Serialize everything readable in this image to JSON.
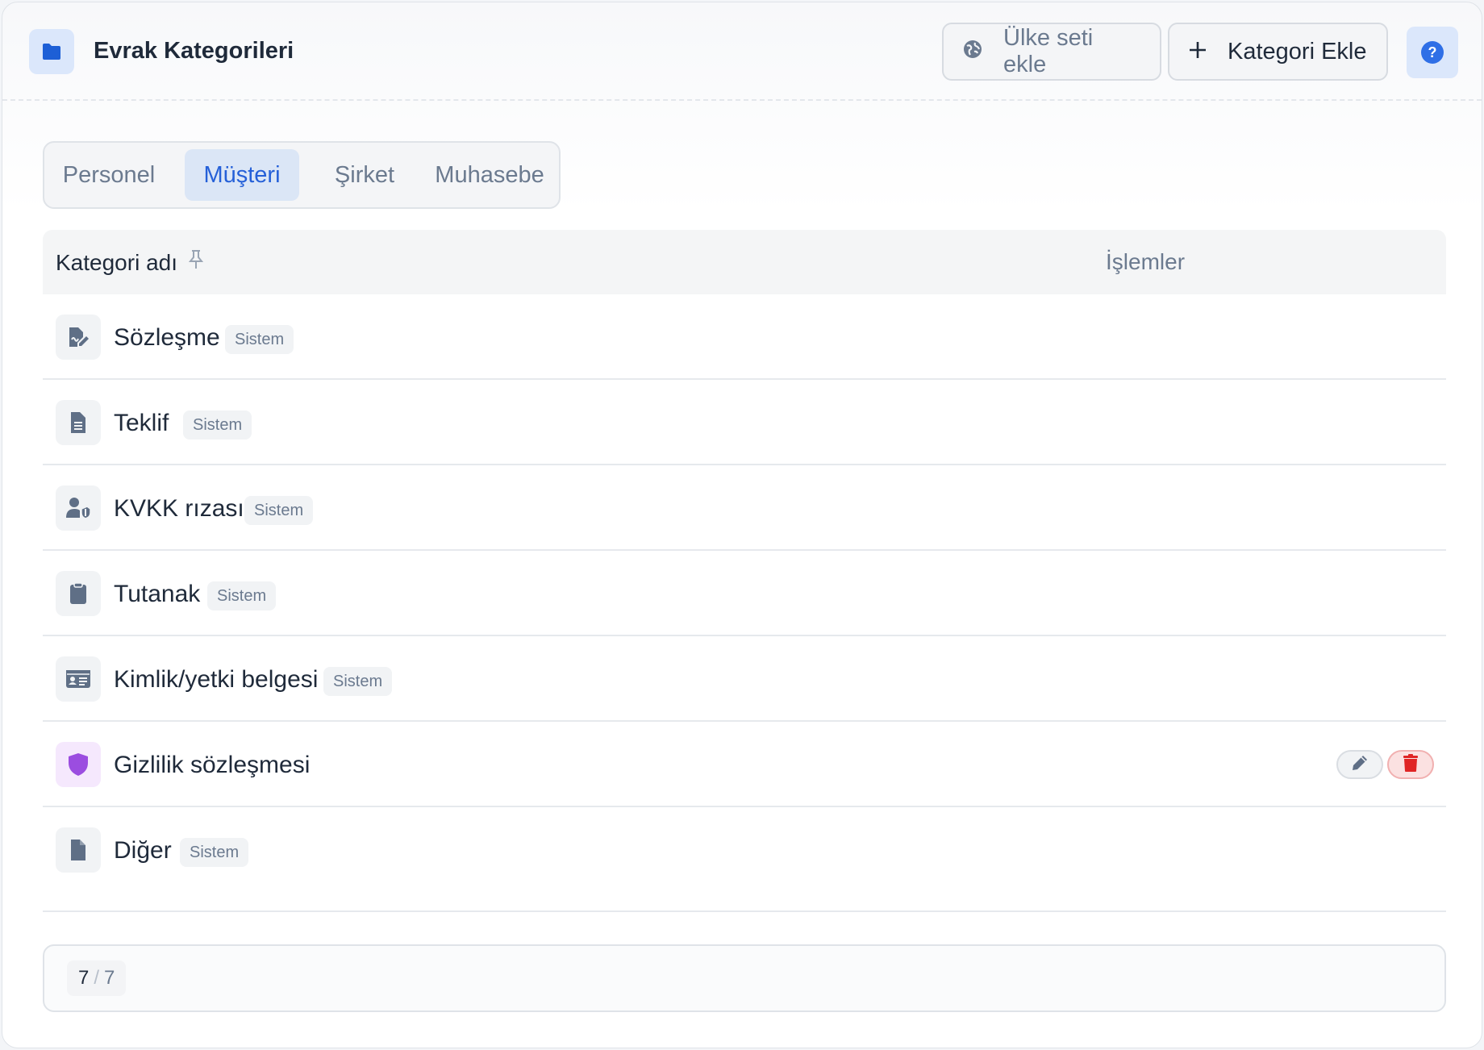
{
  "header": {
    "title": "Evrak Kategorileri",
    "country_button": "Ülke seti ekle",
    "add_button": "Kategori Ekle",
    "help_label": "?"
  },
  "tabs": [
    {
      "label": "Personel",
      "active": false
    },
    {
      "label": "Müşteri",
      "active": true
    },
    {
      "label": "Şirket",
      "active": false
    },
    {
      "label": "Muhasebe",
      "active": false
    }
  ],
  "table": {
    "col_name": "Kategori adı",
    "col_actions": "İşlemler",
    "rows": [
      {
        "name": "Sözleşme",
        "badge": "Sistem",
        "icon": "file-signature-icon"
      },
      {
        "name": "Teklif",
        "badge": "Sistem",
        "icon": "file-text-icon"
      },
      {
        "name": "KVKK rızası",
        "badge": "Sistem",
        "icon": "user-shield-icon"
      },
      {
        "name": "Tutanak",
        "badge": "Sistem",
        "icon": "clipboard-icon"
      },
      {
        "name": "Kimlik/yetki belgesi",
        "badge": "Sistem",
        "icon": "id-card-icon"
      },
      {
        "name": "Gizlilik sözleşmesi",
        "badge": "",
        "icon": "shield-icon",
        "editable": true
      },
      {
        "name": "Diğer",
        "badge": "Sistem",
        "icon": "file-icon"
      }
    ]
  },
  "footer": {
    "current": "7",
    "separator": "/",
    "total": "7"
  },
  "colors": {
    "accent": "#2560d8",
    "danger": "#e02424",
    "purple": "#9b4de0",
    "icon_gray": "#5f6f86"
  }
}
